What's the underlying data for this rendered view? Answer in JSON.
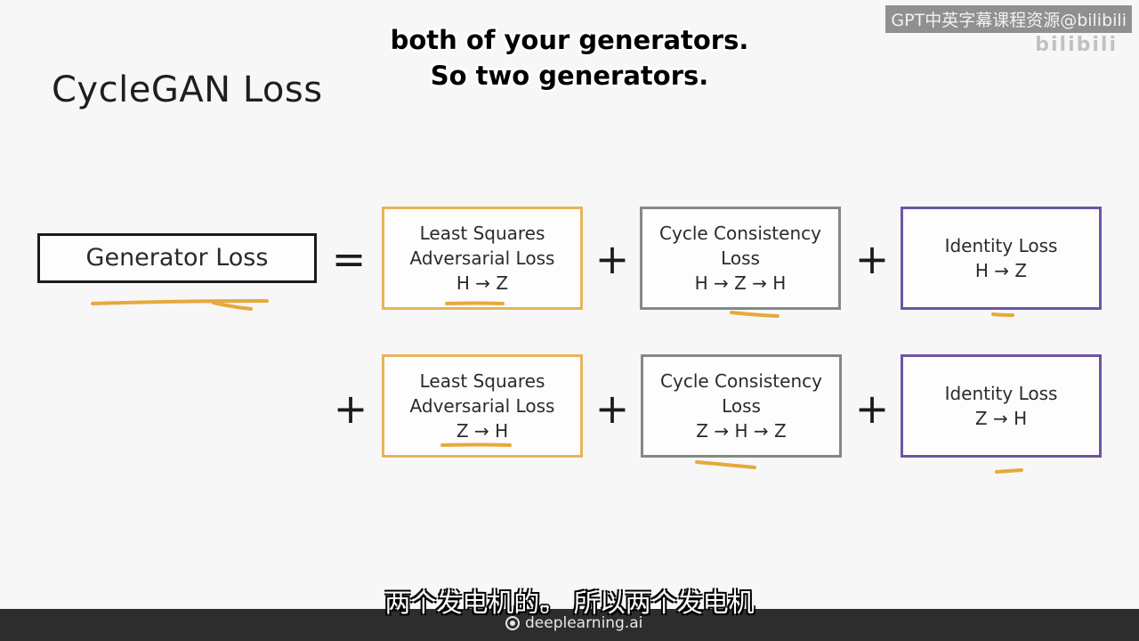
{
  "watermark": {
    "top_label": "GPT中英字幕课程资源@bilibili",
    "faded_label": "bilibili"
  },
  "subtitles": {
    "english_line1": "both of your generators.",
    "english_line2": "So two generators.",
    "chinese": "两个发电机的。 所以两个发电机"
  },
  "slide": {
    "title": "CycleGAN Loss",
    "generator_loss": "Generator Loss",
    "equals": "=",
    "plus": "+",
    "row1": {
      "adversarial": [
        "Least Squares",
        "Adversarial Loss",
        "H → Z"
      ],
      "cycle": [
        "Cycle Consistency",
        "Loss",
        "H → Z → H"
      ],
      "identity": [
        "Identity Loss",
        "H → Z"
      ]
    },
    "row2": {
      "adversarial": [
        "Least Squares",
        "Adversarial Loss",
        "Z → H"
      ],
      "cycle": [
        "Cycle Consistency",
        "Loss",
        "Z → H → Z"
      ],
      "identity": [
        "Identity Loss",
        "Z → H"
      ]
    }
  },
  "footer": {
    "brand": "deeplearning.ai"
  },
  "colors": {
    "adversarial_border": "#e8b35a",
    "cycle_border": "#838a83",
    "identity_border": "#6d55a5",
    "highlight_underline": "#e8a83c"
  }
}
